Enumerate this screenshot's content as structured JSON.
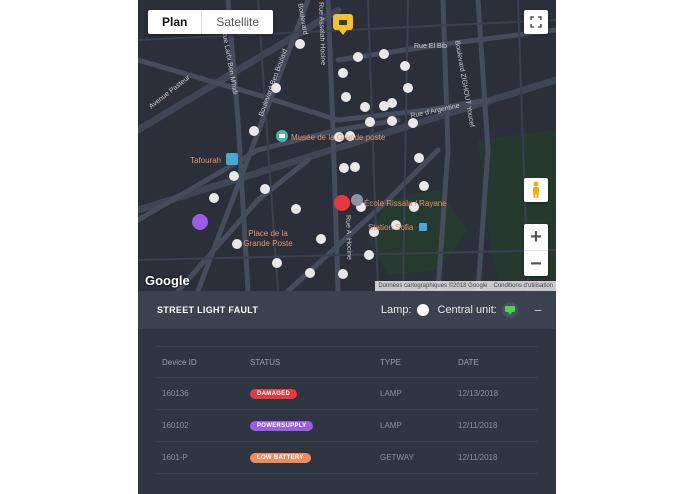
{
  "map": {
    "toggle": {
      "plan": "Plan",
      "satellite": "Satellite"
    },
    "google_logo": "Google",
    "attribution": [
      "Données cartographiques ©2018 Google",
      "Conditions d'utilisation"
    ],
    "labels": {
      "musee": "Musée de la Grande poste",
      "tafourah": "Tafourah",
      "metro": "M",
      "ecole": "École Rissala / Rayane",
      "station": "Station Sofia",
      "place": "Place de la Grande Poste"
    },
    "streets": {
      "pasteur": "Avenue Pasteur",
      "larbi": "Rue Larbi Ben M'hidi",
      "boulevard_ben": "Boulevard Ben Boulaid",
      "boulevard_top": "Boulevard",
      "hocine": "Rue Asselah Hocine",
      "hocine2": "Rue A. Hocine",
      "elbiar": "Rue El Bib",
      "argentine": "Rue d'Argentine",
      "zighout": "Boulevard ZIGHOUT Youcef"
    },
    "colors": {
      "lamp": "#e8e8e8",
      "damaged": "#e8383d",
      "powersupply": "#9b5de5",
      "unit_marker": "#f2c12e"
    }
  },
  "fault_bar": {
    "title": "STREET LIGHT FAULT",
    "lamp_label": "Lamp:",
    "unit_label": "Central unit:",
    "collapse": "−"
  },
  "table": {
    "headers": [
      "Device ID",
      "STATUS",
      "TYPE",
      "DATE"
    ],
    "rows": [
      {
        "id": "160136",
        "status": "DAMAGED",
        "status_color": "#e8383d",
        "type": "LAMP",
        "date": "12/13/2018"
      },
      {
        "id": "160102",
        "status": "POWERSUPPLY",
        "status_color": "#9b5de5",
        "type": "LAMP",
        "date": "12/11/2018"
      },
      {
        "id": "1601-P",
        "status": "LOW BATTERY",
        "status_color": "#f28a5e",
        "type": "GETWAY",
        "date": "12/11/2018"
      }
    ]
  }
}
